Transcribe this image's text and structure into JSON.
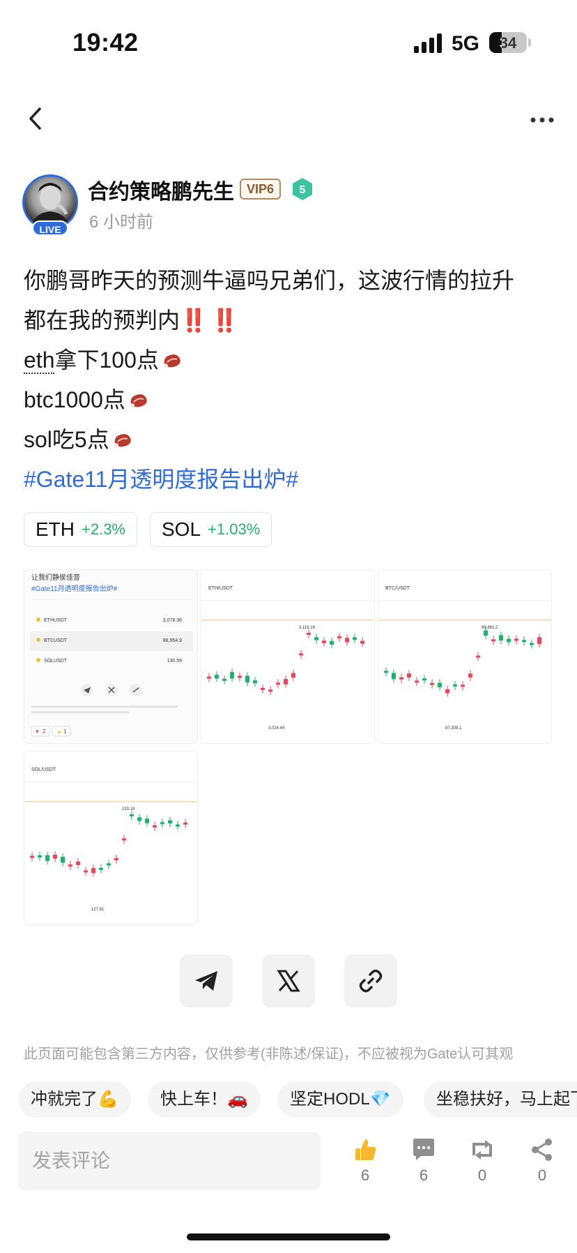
{
  "status_bar": {
    "time": "19:42",
    "network": "5G",
    "battery": "34",
    "battery_level": 0.34
  },
  "nav": {
    "back_icon": "chevron-left-icon",
    "more_icon": "more-horizontal-icon"
  },
  "author": {
    "name": "合约策略鹏先生",
    "vip": "VIP6",
    "level": "5",
    "live_label": "LIVE",
    "time_ago": "6 小时前"
  },
  "post": {
    "line1": "你鹏哥昨天的预测牛逼吗兄弟们，这波行情的拉升",
    "line2": "都在我的预判内",
    "line2_emoji": "‼️ ‼️",
    "line3_prefix": "eth",
    "line3_rest": "拿下100点",
    "line4": "btc1000点",
    "line5": "sol吃5点",
    "hashtag": "#Gate11月透明度报告出炉#"
  },
  "tickers": [
    {
      "symbol": "ETH",
      "change": "+2.3%"
    },
    {
      "symbol": "SOL",
      "change": "+1.03%"
    }
  ],
  "images": {
    "card": {
      "title": "让我们静侯佳音",
      "hashtag": "#Gate11月透明度报告出炉#",
      "rows": [
        {
          "pair": "ETHUSDT",
          "price": "3,078.36"
        },
        {
          "pair": "BTCUSDT",
          "price": "88,954.9"
        },
        {
          "pair": "SOLUSDT",
          "price": "130.59"
        }
      ],
      "likes": "2",
      "thumbs": "1"
    },
    "eth_chart": {
      "pair": "ETH/USDT",
      "high": "3,116.18",
      "low": "3,024.44"
    },
    "btc_chart": {
      "pair": "BTC/USDT",
      "high": "89,882.2",
      "low": "87,308.1"
    },
    "sol_chart": {
      "pair": "SOL/USDT",
      "high": "133.18",
      "low": "127.81"
    }
  },
  "share": {
    "telegram": "telegram-icon",
    "x": "x-icon",
    "link": "link-icon"
  },
  "disclaimer": "此页面可能包含第三方内容，仅供参考(非陈述/保证)，不应被视为Gate认可其观",
  "quick_replies": [
    "冲就完了💪",
    "快上车！🚗",
    "坚定HODL💎",
    "坐稳扶好，马上起飞"
  ],
  "comment": {
    "placeholder": "发表评论"
  },
  "actions": [
    {
      "icon": "thumbs-up-icon",
      "count": "6"
    },
    {
      "icon": "comment-icon",
      "count": "6"
    },
    {
      "icon": "repost-icon",
      "count": "0"
    },
    {
      "icon": "share-icon",
      "count": "0"
    }
  ],
  "colors": {
    "accent": "#2f6bd8",
    "up": "#20b26c",
    "down": "#e8485a",
    "vip": "#8a5c2e"
  }
}
